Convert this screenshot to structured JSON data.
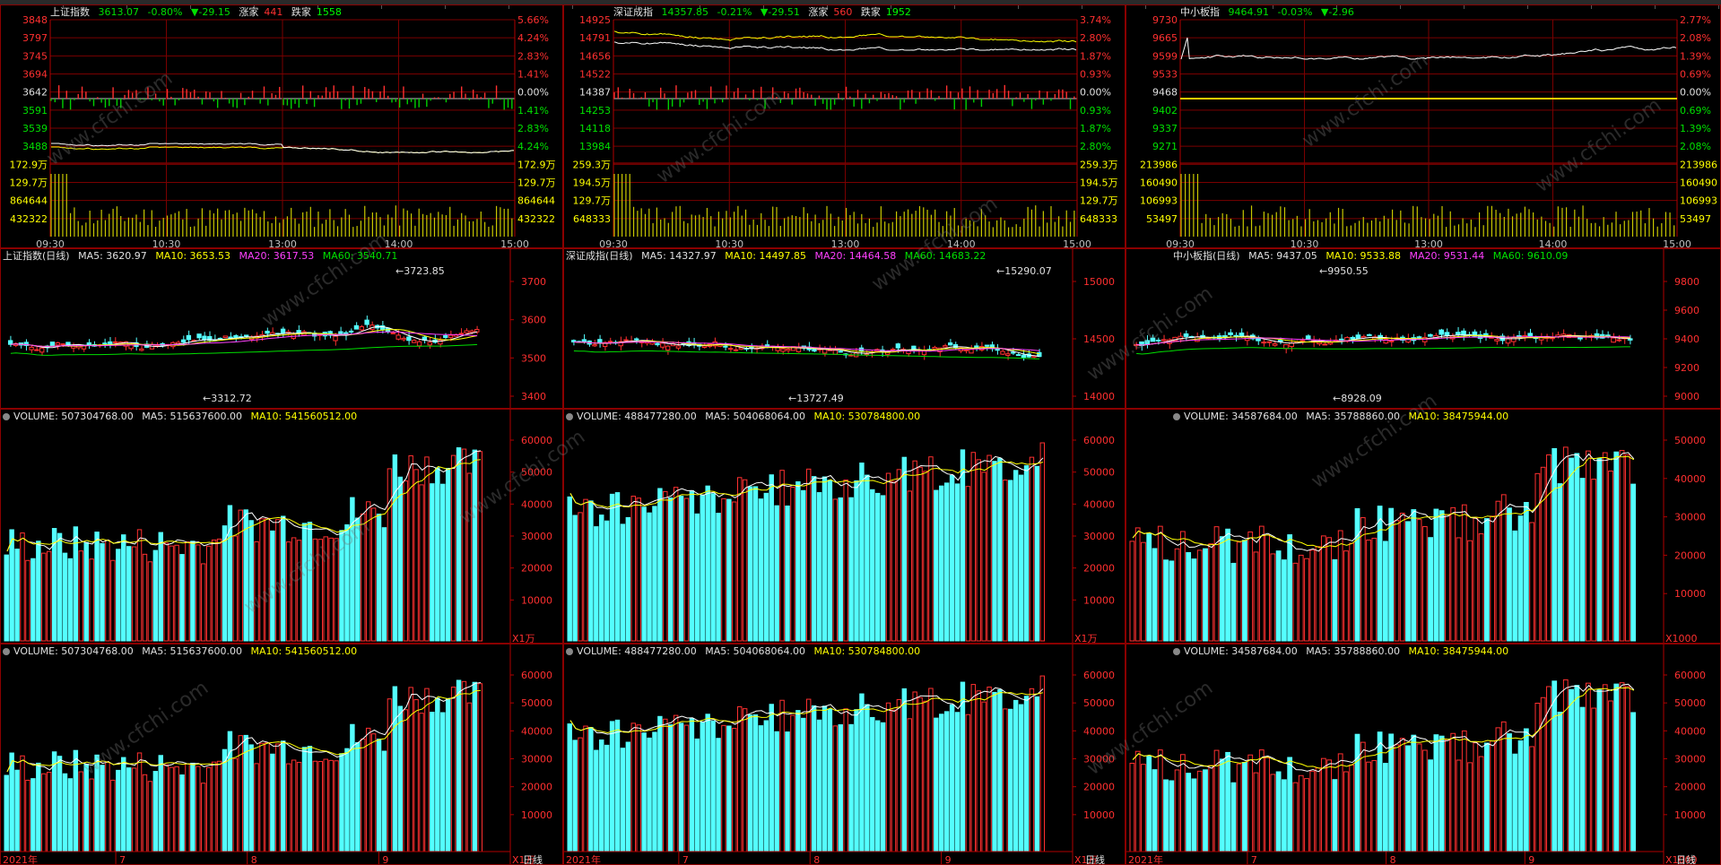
{
  "intraday": [
    {
      "name": "上证指数",
      "price": "3613.07",
      "pct": "-0.80%",
      "chg": "▼-29.15",
      "up_lbl": "涨家",
      "up": "441",
      "dn_lbl": "跌家",
      "dn": "1558",
      "left_ticks": [
        "3848",
        "3797",
        "3745",
        "3694",
        "3642",
        "3591",
        "3539",
        "3488",
        "172.9万",
        "129.7万",
        "864644",
        "432322"
      ],
      "right_ticks": [
        "5.66%",
        "4.24%",
        "2.83%",
        "1.41%",
        "0.00%",
        "1.41%",
        "2.83%",
        "4.24%",
        "172.9万",
        "129.7万",
        "864644",
        "432322"
      ],
      "times": [
        "09:30",
        "10:30",
        "13:00",
        "14:00",
        "15:00"
      ]
    },
    {
      "name": "深证成指",
      "price": "14357.85",
      "pct": "-0.21%",
      "chg": "▼-29.51",
      "up_lbl": "涨家",
      "up": "560",
      "dn_lbl": "跌家",
      "dn": "1952",
      "left_ticks": [
        "14925",
        "14791",
        "14656",
        "14522",
        "14387",
        "14253",
        "14118",
        "13984",
        "259.3万",
        "194.5万",
        "129.7万",
        "648333"
      ],
      "right_ticks": [
        "3.74%",
        "2.80%",
        "1.87%",
        "0.93%",
        "0.00%",
        "0.93%",
        "1.87%",
        "2.80%",
        "259.3万",
        "194.5万",
        "129.7万",
        "648333"
      ],
      "times": [
        "09:30",
        "10:30",
        "13:00",
        "14:00",
        "15:00"
      ]
    },
    {
      "name": "中小板指",
      "price": "9464.91",
      "pct": "-0.03%",
      "chg": "▼-2.96",
      "up_lbl": "",
      "up": "",
      "dn_lbl": "",
      "dn": "",
      "left_ticks": [
        "9730",
        "9665",
        "9599",
        "9533",
        "9468",
        "9402",
        "9337",
        "9271",
        "213986",
        "160490",
        "106993",
        "53497"
      ],
      "right_ticks": [
        "2.77%",
        "2.08%",
        "1.39%",
        "0.69%",
        "0.00%",
        "0.69%",
        "1.39%",
        "2.08%",
        "213986",
        "160490",
        "106993",
        "53497"
      ],
      "times": [
        "09:30",
        "10:30",
        "13:00",
        "14:00",
        "15:00"
      ]
    }
  ],
  "daily": [
    {
      "title": "上证指数(日线)",
      "ma5": "MA5: 3620.97",
      "ma10": "MA10: 3653.53",
      "ma20": "MA20: 3617.53",
      "ma60": "MA60: 3540.71",
      "high": "3723.85",
      "low": "3312.72",
      "ticks": [
        "3700",
        "3600",
        "3500",
        "3400"
      ]
    },
    {
      "title": "深证成指(日线)",
      "ma5": "MA5: 14327.97",
      "ma10": "MA10: 14497.85",
      "ma20": "MA20: 14464.58",
      "ma60": "MA60: 14683.22",
      "high": "15290.07",
      "low": "13727.49",
      "ticks": [
        "15000",
        "14500",
        "14000"
      ]
    },
    {
      "title": "中小板指(日线)",
      "ma5": "MA5: 9437.05",
      "ma10": "MA10: 9533.88",
      "ma20": "MA20: 9531.44",
      "ma60": "MA60: 9610.09",
      "high": "9950.55",
      "low": "8928.09",
      "ticks": [
        "9800",
        "9600",
        "9400",
        "9200",
        "9000"
      ]
    }
  ],
  "volume": [
    {
      "vol": "VOLUME: 507304768.00",
      "ma5": "MA5: 515637600.00",
      "ma10": "MA10: 541560512.00",
      "ticks": [
        "60000",
        "50000",
        "40000",
        "30000",
        "20000",
        "10000"
      ],
      "unit": "X1万"
    },
    {
      "vol": "VOLUME: 488477280.00",
      "ma5": "MA5: 504068064.00",
      "ma10": "MA10: 530784800.00",
      "ticks": [
        "60000",
        "50000",
        "40000",
        "30000",
        "20000",
        "10000"
      ],
      "unit": "X1万"
    },
    {
      "vol": "VOLUME: 34587684.00",
      "ma5": "MA5: 35788860.00",
      "ma10": "MA10: 38475944.00",
      "ticks": [
        "50000",
        "40000",
        "30000",
        "20000",
        "10000"
      ],
      "unit": "X1000"
    }
  ],
  "volume2_ticks": [
    [
      "60000",
      "50000",
      "40000",
      "30000",
      "20000",
      "10000"
    ],
    [
      "60000",
      "50000",
      "40000",
      "30000",
      "20000",
      "10000"
    ],
    [
      "60000",
      "50000",
      "40000",
      "30000",
      "20000",
      "10000"
    ]
  ],
  "date_axis": {
    "year": "2021年",
    "months": [
      "7",
      "8",
      "9"
    ],
    "period": "日线"
  },
  "watermark": "www.cfchi.com"
}
